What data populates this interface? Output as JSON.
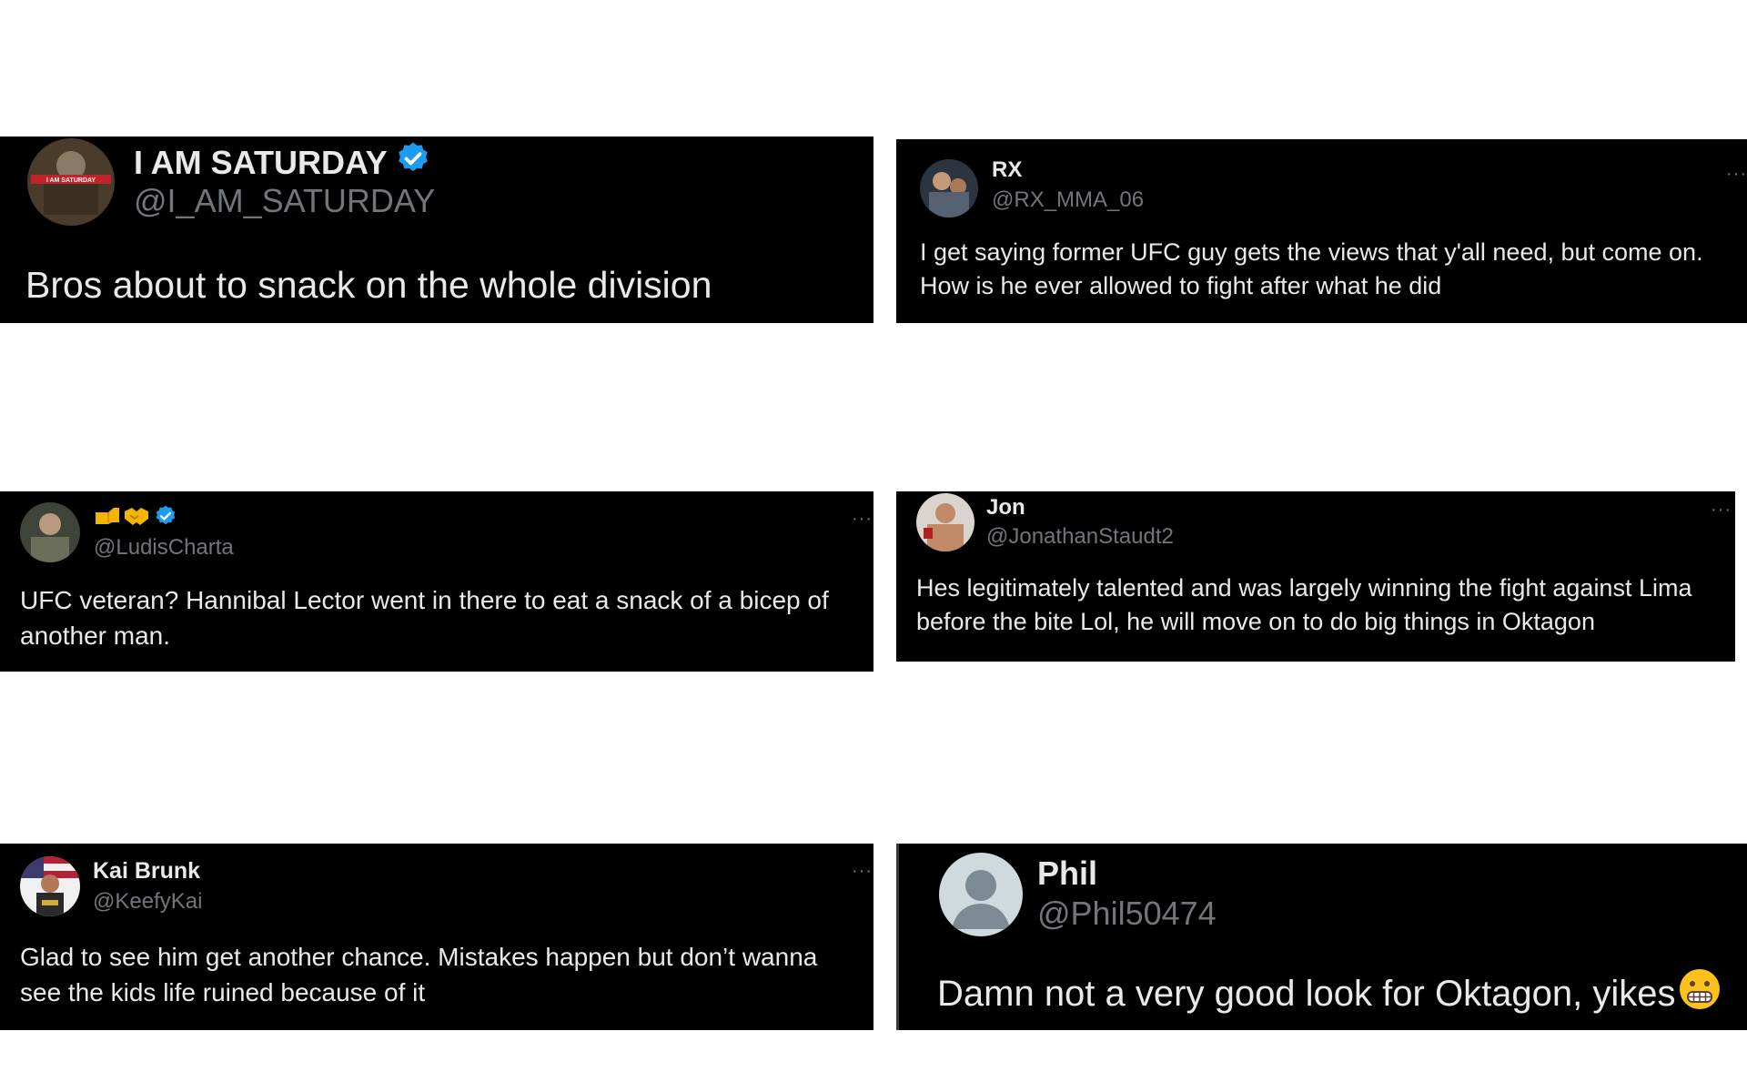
{
  "tweets": [
    {
      "name": "I AM SATURDAY",
      "verified": true,
      "handle": "@I_AM_SATURDAY",
      "text": "Bros about to snack on the whole division",
      "avatar_label": "I AM SATURDAY"
    },
    {
      "name": "RX",
      "verified": false,
      "handle": "@RX_MMA_06",
      "text": "I get saying former UFC guy gets the views that y'all need, but come on. How is he ever allowed to fight after what he did"
    },
    {
      "name": "",
      "name_emoji": [
        "fist-emoji",
        "handshake-emoji"
      ],
      "verified": true,
      "handle": "@LudisCharta",
      "text": "UFC veteran? Hannibal Lector went in there to eat a snack of a bicep of another man."
    },
    {
      "name": "Jon",
      "verified": false,
      "handle": "@JonathanStaudt2",
      "text": "Hes legitimately talented and was largely winning the fight against Lima before the bite Lol, he will move on to do big things in Oktagon"
    },
    {
      "name": "Kai Brunk",
      "verified": false,
      "handle": "@KeefyKai",
      "text": "Glad to see him get another chance. Mistakes happen but don’t wanna see the kids life ruined because of it"
    },
    {
      "name": "Phil",
      "verified": false,
      "handle": "@Phil50474",
      "text": "Damn not a very good look for Oktagon, yikes",
      "trailing_emoji": "grimacing-face-emoji"
    }
  ],
  "more_label": "···",
  "colors": {
    "card_bg": "#000000",
    "text": "#e7e9ea",
    "handle": "#71767b",
    "verified": "#1d9bf0"
  }
}
